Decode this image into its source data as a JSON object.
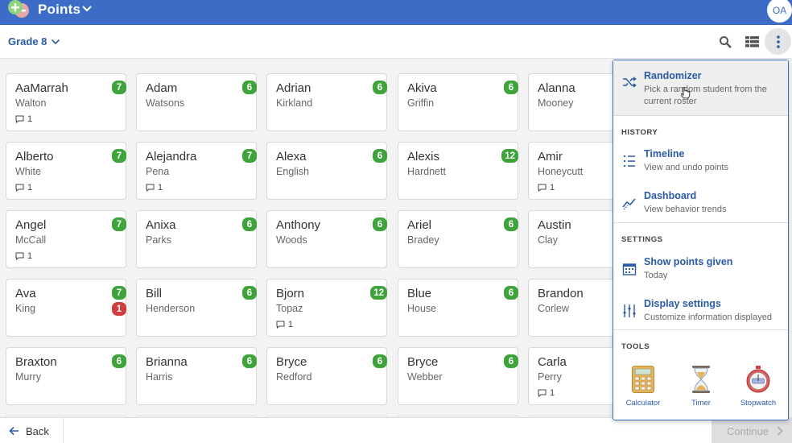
{
  "app": {
    "title": "Points",
    "avatar_initials": "OA"
  },
  "toolbar": {
    "grade": "Grade 8"
  },
  "students": [
    [
      {
        "first": "AaMarrah",
        "last": "Walton",
        "points": "7",
        "comments": "1"
      },
      {
        "first": "Adam",
        "last": "Watsons",
        "points": "6"
      },
      {
        "first": "Adrian",
        "last": "Kirkland",
        "points": "6"
      },
      {
        "first": "Akiva",
        "last": "Griffin",
        "points": "6"
      },
      {
        "first": "Alanna",
        "last": "Mooney"
      }
    ],
    [
      {
        "first": "Alberto",
        "last": "White",
        "points": "7",
        "comments": "1"
      },
      {
        "first": "Alejandra",
        "last": "Pena",
        "points": "7",
        "comments": "1"
      },
      {
        "first": "Alexa",
        "last": "English",
        "points": "6"
      },
      {
        "first": "Alexis",
        "last": "Hardnett",
        "points": "12"
      },
      {
        "first": "Amir",
        "last": "Honeycutt",
        "comments": "1"
      }
    ],
    [
      {
        "first": "Angel",
        "last": "McCall",
        "points": "7",
        "comments": "1"
      },
      {
        "first": "Anixa",
        "last": "Parks",
        "points": "6"
      },
      {
        "first": "Anthony",
        "last": "Woods",
        "points": "6"
      },
      {
        "first": "Ariel",
        "last": "Bradey",
        "points": "6"
      },
      {
        "first": "Austin",
        "last": "Clay"
      }
    ],
    [
      {
        "first": "Ava",
        "last": "King",
        "points": "7",
        "negative": "1"
      },
      {
        "first": "Bill",
        "last": "Henderson",
        "points": "6"
      },
      {
        "first": "Bjorn",
        "last": "Topaz",
        "points": "12",
        "comments": "1"
      },
      {
        "first": "Blue",
        "last": "House",
        "points": "6"
      },
      {
        "first": "Brandon",
        "last": "Corlew"
      }
    ],
    [
      {
        "first": "Braxton",
        "last": "Murry",
        "points": "6"
      },
      {
        "first": "Brianna",
        "last": "Harris",
        "points": "6"
      },
      {
        "first": "Bryce",
        "last": "Redford",
        "points": "6"
      },
      {
        "first": "Bryce",
        "last": "Webber",
        "points": "6"
      },
      {
        "first": "Carla",
        "last": "Perry",
        "comments": "1"
      }
    ]
  ],
  "menu": {
    "randomizer": {
      "title": "Randomizer",
      "desc": "Pick a random student from the current roster"
    },
    "history_label": "HISTORY",
    "timeline": {
      "title": "Timeline",
      "desc": "View and undo points"
    },
    "dashboard": {
      "title": "Dashboard",
      "desc": "View behavior trends"
    },
    "settings_label": "SETTINGS",
    "show_points": {
      "title": "Show points given",
      "desc": "Today"
    },
    "display_settings": {
      "title": "Display settings",
      "desc": "Customize information displayed"
    },
    "tools_label": "TOOLS",
    "tools": {
      "calculator": "Calculator",
      "timer": "Timer",
      "stopwatch": "Stopwatch"
    }
  },
  "footer": {
    "back": "Back",
    "continue": "Continue"
  },
  "colors": {
    "brand": "#3c6cc6",
    "positive": "#3ea33a",
    "negative": "#d23c3c"
  }
}
